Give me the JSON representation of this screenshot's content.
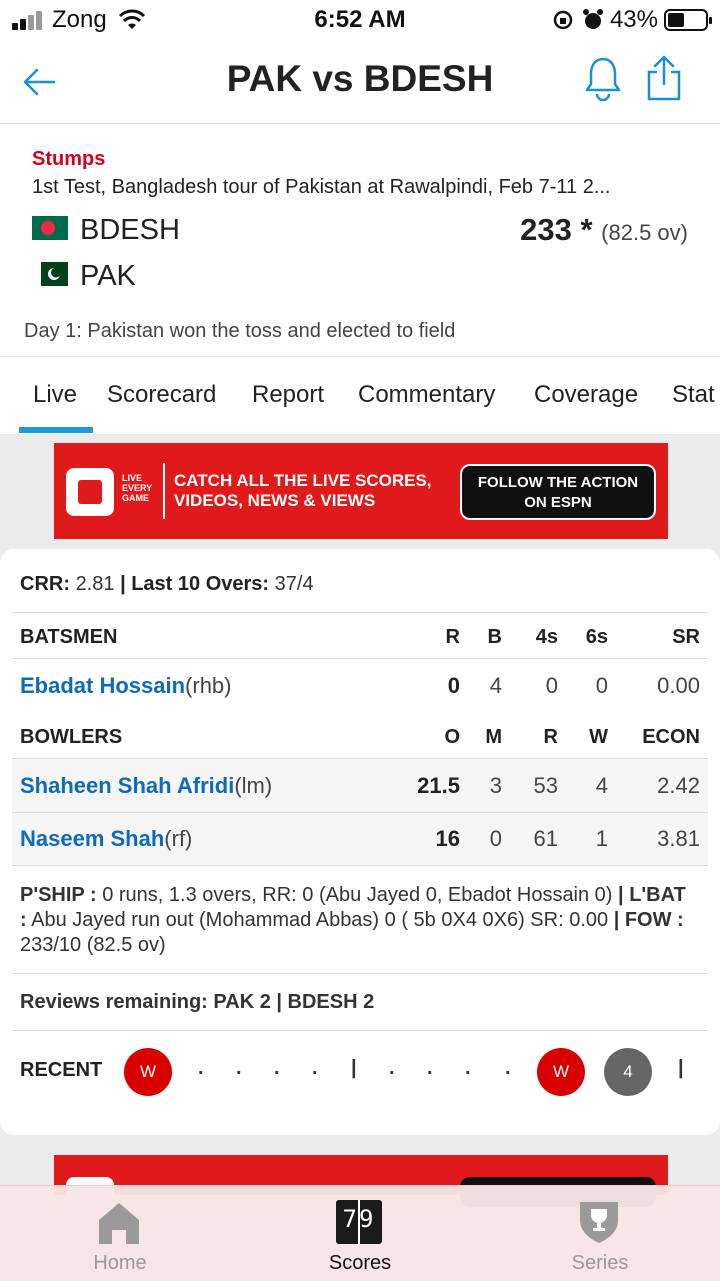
{
  "status_bar": {
    "carrier": "Zong",
    "time": "6:52 AM",
    "battery": "43%"
  },
  "header": {
    "title": "PAK vs BDESH"
  },
  "match": {
    "status": "Stumps",
    "series": "1st Test, Bangladesh tour of Pakistan at Rawalpindi, Feb 7-11 2...",
    "team1": {
      "name": "BDESH",
      "score": "233 *",
      "overs": "(82.5 ov)"
    },
    "team2": {
      "name": "PAK"
    },
    "note": "Day 1: Pakistan won the toss and elected to field"
  },
  "tabs": [
    "Live",
    "Scorecard",
    "Report",
    "Commentary",
    "Coverage",
    "Stat"
  ],
  "ad": {
    "tiny": "LIVE EVERY GAME",
    "line1": "CATCH ALL THE LIVE SCORES,",
    "line2": "VIDEOS, NEWS & VIEWS",
    "cta1": "FOLLOW THE ACTION",
    "cta2": "ON ESPN"
  },
  "live": {
    "crr_label": "CRR:",
    "crr": "2.81",
    "last10_label": "Last 10 Overs:",
    "last10": "37/4",
    "batsmen_header": {
      "label": "BATSMEN",
      "cols": [
        "R",
        "B",
        "4s",
        "6s",
        "SR"
      ]
    },
    "batsmen": [
      {
        "name": "Ebadat Hossain",
        "style": "(rhb)",
        "stats": [
          "0",
          "4",
          "0",
          "0",
          "0.00"
        ]
      }
    ],
    "bowlers_header": {
      "label": "BOWLERS",
      "cols": [
        "O",
        "M",
        "R",
        "W",
        "ECON"
      ]
    },
    "bowlers": [
      {
        "name": "Shaheen Shah Afridi",
        "style": "(lm)",
        "stats": [
          "21.5",
          "3",
          "53",
          "4",
          "2.42"
        ]
      },
      {
        "name": "Naseem Shah",
        "style": "(rf)",
        "stats": [
          "16",
          "0",
          "61",
          "1",
          "3.81"
        ]
      }
    ],
    "pship_label": "P'SHIP :",
    "pship": "0 runs, 1.3 overs, RR: 0 (Abu Jayed 0, Ebadot Hossain 0)",
    "lbat_label": "L'BAT :",
    "lbat": "Abu Jayed run out (Mohammad Abbas) 0 ( 5b 0X4 0X6) SR: 0.00",
    "fow_label": "FOW :",
    "fow": "233/10 (82.5 ov)",
    "reviews_label": "Reviews remaining:",
    "reviews_pak": "PAK 2",
    "reviews_bdesh": "BDESH 2",
    "recent_label": "RECENT",
    "recent_w": "W",
    "recent_dot": ".",
    "recent_sep": "|",
    "recent_four": "4"
  },
  "tabbar": {
    "home": "Home",
    "scores": "Scores",
    "series": "Series",
    "scores_icon_text": "79"
  },
  "colors": {
    "accent_blue": "#1a9bdc",
    "link_blue": "#0e6bb8",
    "stumps_red": "#d0021b",
    "ad_red": "#e01a1a"
  }
}
